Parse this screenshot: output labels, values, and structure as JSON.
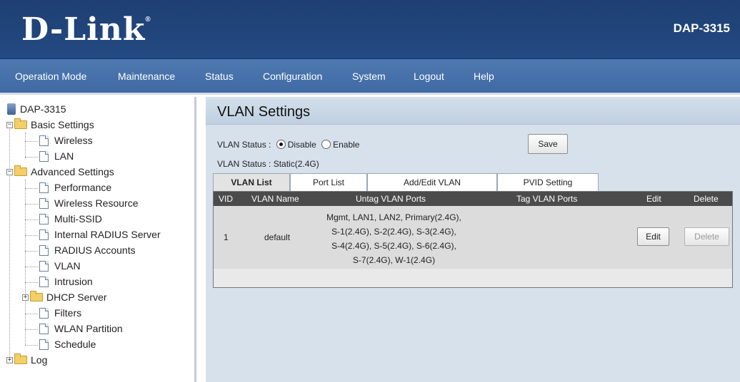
{
  "header": {
    "brand": "D-Link",
    "model": "DAP-3315"
  },
  "nav": [
    "Operation Mode",
    "Maintenance",
    "Status",
    "Configuration",
    "System",
    "Logout",
    "Help"
  ],
  "sidebar": {
    "root": "DAP-3315",
    "basic": "Basic Settings",
    "basic_items": [
      "Wireless",
      "LAN"
    ],
    "advanced": "Advanced Settings",
    "advanced_items": [
      "Performance",
      "Wireless Resource",
      "Multi-SSID",
      "Internal RADIUS Server",
      "RADIUS Accounts",
      "VLAN",
      "Intrusion"
    ],
    "dhcp": "DHCP Server",
    "advanced_items2": [
      "Filters",
      "WLAN Partition",
      "Schedule"
    ],
    "log": "Log"
  },
  "page": {
    "title": "VLAN Settings",
    "vlan_status_label": "VLAN Status :",
    "disable_label": "Disable",
    "enable_label": "Enable",
    "selected": "Disable",
    "status_line": "VLAN Status : Static(2.4G)",
    "save_label": "Save"
  },
  "tabs": [
    "VLAN List",
    "Port List",
    "Add/Edit VLAN",
    "PVID Setting"
  ],
  "table": {
    "headers": [
      "VID",
      "VLAN Name",
      "Untag VLAN Ports",
      "Tag VLAN Ports",
      "Edit",
      "Delete"
    ],
    "rows": [
      {
        "vid": "1",
        "name": "default",
        "untag_lines": [
          "Mgmt, LAN1, LAN2, Primary(2.4G),",
          "S-1(2.4G), S-2(2.4G), S-3(2.4G),",
          "S-4(2.4G), S-5(2.4G), S-6(2.4G),",
          "S-7(2.4G), W-1(2.4G)"
        ],
        "tag": "",
        "edit": "Edit",
        "delete": "Delete"
      }
    ]
  }
}
